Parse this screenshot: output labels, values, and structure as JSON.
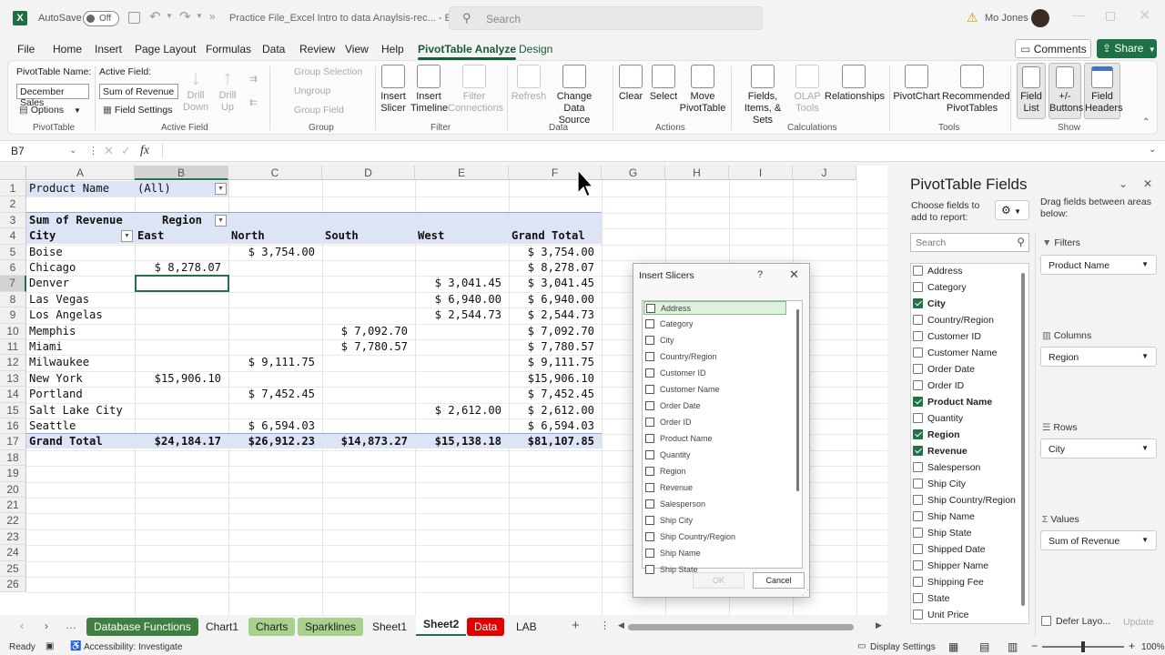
{
  "window": {
    "autosave_label": "AutoSave",
    "autosave_state": "Off",
    "file_title": "Practice File_Excel Intro to data Anaylsis-rec... - E...",
    "search_placeholder": "Search",
    "user_name": "Mo Jones"
  },
  "menu": {
    "items": [
      "File",
      "Home",
      "Insert",
      "Page Layout",
      "Formulas",
      "Data",
      "Review",
      "View",
      "Help",
      "PivotTable Analyze",
      "Design"
    ],
    "active": "PivotTable Analyze",
    "comments": "Comments",
    "share": "Share"
  },
  "ribbon": {
    "pivottable_name_label": "PivotTable Name:",
    "pivottable_name_value": "December Sales",
    "options": "Options",
    "active_field_label": "Active Field:",
    "active_field_value": "Sum of Revenue",
    "field_settings": "Field Settings",
    "drill_down": "Drill Down",
    "drill_up": "Drill Up",
    "group_selection": "Group Selection",
    "ungroup": "Ungroup",
    "group_field": "Group Field",
    "insert_slicer": "Insert Slicer",
    "insert_timeline": "Insert Timeline",
    "filter_connections": "Filter Connections",
    "refresh": "Refresh",
    "change_data_source": "Change Data Source",
    "clear": "Clear",
    "select": "Select",
    "move_pivottable": "Move PivotTable",
    "fields_items_sets": "Fields, Items, & Sets",
    "olap_tools": "OLAP Tools",
    "relationships": "Relationships",
    "pivotchart": "PivotChart",
    "recommended_pivottables": "Recommended PivotTables",
    "field_list": "Field List",
    "buttons": "+/- Buttons",
    "field_headers": "Field Headers",
    "groups": [
      "PivotTable",
      "Active Field",
      "Group",
      "Filter",
      "Data",
      "Actions",
      "Calculations",
      "Tools",
      "Show"
    ]
  },
  "formula_bar": {
    "name_box": "B7",
    "fx": "fx",
    "content": ""
  },
  "grid": {
    "columns": [
      "A",
      "B",
      "C",
      "D",
      "E",
      "F",
      "G",
      "H",
      "I",
      "J"
    ],
    "rows": [
      "1",
      "2",
      "3",
      "4",
      "5",
      "6",
      "7",
      "8",
      "9",
      "10",
      "11",
      "12",
      "13",
      "14",
      "15",
      "16",
      "17",
      "18",
      "19",
      "20",
      "21",
      "22",
      "23",
      "24",
      "25",
      "26"
    ],
    "filter_label": "Product Name",
    "filter_value": "(All)",
    "values_label": "Sum of Revenue",
    "col_labels": "Region",
    "row_labels": "City",
    "headers": [
      "East",
      "North",
      "South",
      "West",
      "Grand Total"
    ],
    "data": [
      [
        "Boise",
        "",
        "$ 3,754.00",
        "",
        "",
        "$ 3,754.00"
      ],
      [
        "Chicago",
        "$ 8,278.07",
        "",
        "",
        "",
        "$ 8,278.07"
      ],
      [
        "Denver",
        "",
        "",
        "",
        "$ 3,041.45",
        "$ 3,041.45"
      ],
      [
        "Las Vegas",
        "",
        "",
        "",
        "$ 6,940.00",
        "$ 6,940.00"
      ],
      [
        "Los Angelas",
        "",
        "",
        "",
        "$ 2,544.73",
        "$ 2,544.73"
      ],
      [
        "Memphis",
        "",
        "",
        "$ 7,092.70",
        "",
        "$ 7,092.70"
      ],
      [
        "Miami",
        "",
        "",
        "$ 7,780.57",
        "",
        "$ 7,780.57"
      ],
      [
        "Milwaukee",
        "",
        "$ 9,111.75",
        "",
        "",
        "$ 9,111.75"
      ],
      [
        "New York",
        "$15,906.10",
        "",
        "",
        "",
        "$15,906.10"
      ],
      [
        "Portland",
        "",
        "$ 7,452.45",
        "",
        "",
        "$ 7,452.45"
      ],
      [
        "Salt Lake City",
        "",
        "",
        "",
        "$ 2,612.00",
        "$ 2,612.00"
      ],
      [
        "Seattle",
        "",
        "$ 6,594.03",
        "",
        "",
        "$ 6,594.03"
      ]
    ],
    "grand_total": [
      "Grand Total",
      "$24,184.17",
      "$26,912.23",
      "$14,873.27",
      "$15,138.18",
      "$81,107.85"
    ]
  },
  "sheet_tabs": [
    {
      "label": "Database Functions",
      "color": "#3f7f3f",
      "text": "#fff"
    },
    {
      "label": "Chart1",
      "color": "",
      "text": "#222"
    },
    {
      "label": "Charts",
      "color": "#a9d18e",
      "text": "#222"
    },
    {
      "label": "Sparklines",
      "color": "#a9d18e",
      "text": "#222"
    },
    {
      "label": "Sheet1",
      "color": "",
      "text": "#222"
    },
    {
      "label": "Sheet2",
      "color": "",
      "text": "#222"
    },
    {
      "label": "Data",
      "color": "#e00000",
      "text": "#fff"
    },
    {
      "label": "LAB",
      "color": "",
      "text": "#222"
    }
  ],
  "active_tab": "Sheet2",
  "status": {
    "ready": "Ready",
    "accessibility": "Accessibility: Investigate",
    "display_settings": "Display Settings",
    "zoom": "100%"
  },
  "panel": {
    "title": "PivotTable Fields",
    "choose_label": "Choose fields to add to report:",
    "drag_label": "Drag fields between areas below:",
    "search_placeholder": "Search",
    "fields": [
      {
        "name": "Address",
        "checked": false
      },
      {
        "name": "Category",
        "checked": false
      },
      {
        "name": "City",
        "checked": true
      },
      {
        "name": "Country/Region",
        "checked": false
      },
      {
        "name": "Customer ID",
        "checked": false
      },
      {
        "name": "Customer Name",
        "checked": false
      },
      {
        "name": "Order Date",
        "checked": false
      },
      {
        "name": "Order ID",
        "checked": false
      },
      {
        "name": "Product Name",
        "checked": true
      },
      {
        "name": "Quantity",
        "checked": false
      },
      {
        "name": "Region",
        "checked": true
      },
      {
        "name": "Revenue",
        "checked": true
      },
      {
        "name": "Salesperson",
        "checked": false
      },
      {
        "name": "Ship City",
        "checked": false
      },
      {
        "name": "Ship Country/Region",
        "checked": false
      },
      {
        "name": "Ship Name",
        "checked": false
      },
      {
        "name": "Ship State",
        "checked": false
      },
      {
        "name": "Shipped Date",
        "checked": false
      },
      {
        "name": "Shipper Name",
        "checked": false
      },
      {
        "name": "Shipping Fee",
        "checked": false
      },
      {
        "name": "State",
        "checked": false
      },
      {
        "name": "Unit Price",
        "checked": false
      }
    ],
    "filters_label": "Filters",
    "filters_value": "Product Name",
    "columns_label": "Columns",
    "columns_value": "Region",
    "rows_label": "Rows",
    "rows_value": "City",
    "values_label": "Values",
    "values_value": "Sum of Revenue",
    "defer_label": "Defer Layo...",
    "update": "Update"
  },
  "dialog": {
    "title": "Insert Slicers",
    "help": "?",
    "items": [
      "Address",
      "Category",
      "City",
      "Country/Region",
      "Customer ID",
      "Customer Name",
      "Order Date",
      "Order ID",
      "Product Name",
      "Quantity",
      "Region",
      "Revenue",
      "Salesperson",
      "Ship City",
      "Ship Country/Region",
      "Ship Name",
      "Ship State"
    ],
    "ok": "OK",
    "cancel": "Cancel"
  }
}
